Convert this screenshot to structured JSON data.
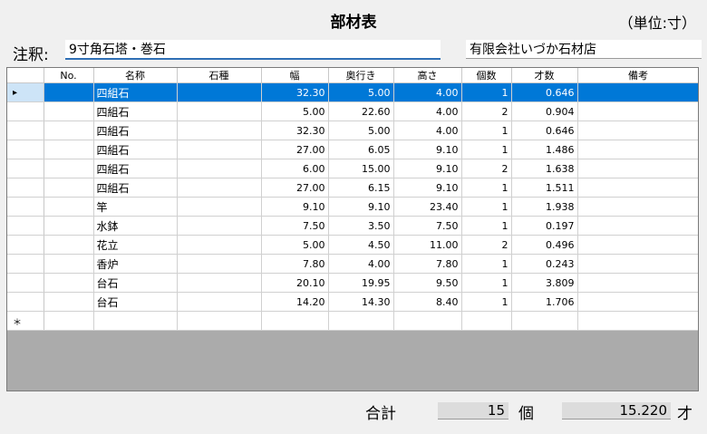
{
  "header": {
    "title": "部材表",
    "unit": "（単位:寸）"
  },
  "note": {
    "label": "注釈:",
    "value": "9寸角石塔・巻石"
  },
  "company": {
    "value": "有限会社いづか石材店"
  },
  "table": {
    "columns": [
      "",
      "No.",
      "名称",
      "石種",
      "幅",
      "奥行き",
      "高さ",
      "個数",
      "才数",
      "備考"
    ],
    "selected_row_marker": "▸",
    "new_row_marker": "＊",
    "rows": [
      {
        "no": "",
        "name": "四組石",
        "stone": "",
        "width": "32.30",
        "depth": "5.00",
        "height": "4.00",
        "count": "1",
        "volume": "0.646",
        "remarks": ""
      },
      {
        "no": "",
        "name": "四組石",
        "stone": "",
        "width": "5.00",
        "depth": "22.60",
        "height": "4.00",
        "count": "2",
        "volume": "0.904",
        "remarks": ""
      },
      {
        "no": "",
        "name": "四組石",
        "stone": "",
        "width": "32.30",
        "depth": "5.00",
        "height": "4.00",
        "count": "1",
        "volume": "0.646",
        "remarks": ""
      },
      {
        "no": "",
        "name": "四組石",
        "stone": "",
        "width": "27.00",
        "depth": "6.05",
        "height": "9.10",
        "count": "1",
        "volume": "1.486",
        "remarks": ""
      },
      {
        "no": "",
        "name": "四組石",
        "stone": "",
        "width": "6.00",
        "depth": "15.00",
        "height": "9.10",
        "count": "2",
        "volume": "1.638",
        "remarks": ""
      },
      {
        "no": "",
        "name": "四組石",
        "stone": "",
        "width": "27.00",
        "depth": "6.15",
        "height": "9.10",
        "count": "1",
        "volume": "1.511",
        "remarks": ""
      },
      {
        "no": "",
        "name": "竿",
        "stone": "",
        "width": "9.10",
        "depth": "9.10",
        "height": "23.40",
        "count": "1",
        "volume": "1.938",
        "remarks": ""
      },
      {
        "no": "",
        "name": "水鉢",
        "stone": "",
        "width": "7.50",
        "depth": "3.50",
        "height": "7.50",
        "count": "1",
        "volume": "0.197",
        "remarks": ""
      },
      {
        "no": "",
        "name": "花立",
        "stone": "",
        "width": "5.00",
        "depth": "4.50",
        "height": "11.00",
        "count": "2",
        "volume": "0.496",
        "remarks": ""
      },
      {
        "no": "",
        "name": "香炉",
        "stone": "",
        "width": "7.80",
        "depth": "4.00",
        "height": "7.80",
        "count": "1",
        "volume": "0.243",
        "remarks": ""
      },
      {
        "no": "",
        "name": "台石",
        "stone": "",
        "width": "20.10",
        "depth": "19.95",
        "height": "9.50",
        "count": "1",
        "volume": "3.809",
        "remarks": ""
      },
      {
        "no": "",
        "name": "台石",
        "stone": "",
        "width": "14.20",
        "depth": "14.30",
        "height": "8.40",
        "count": "1",
        "volume": "1.706",
        "remarks": ""
      }
    ]
  },
  "footer": {
    "total_label": "合計",
    "total_count": "15",
    "count_unit": "個",
    "total_volume": "15.220",
    "volume_unit": "才"
  },
  "colors": {
    "selection": "#0078d7",
    "input_underline": "#2f6fb5"
  }
}
